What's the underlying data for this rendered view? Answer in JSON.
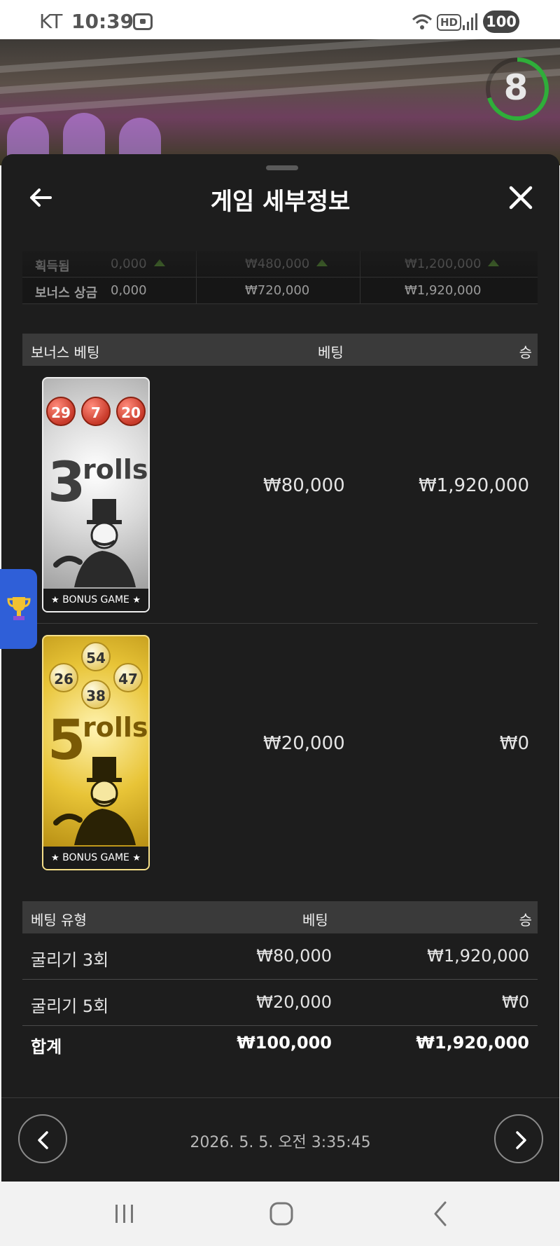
{
  "status_bar": {
    "carrier": "KT",
    "time": "10:39",
    "battery": "100"
  },
  "timer": {
    "value": "8",
    "progress_fraction": 0.7
  },
  "panel": {
    "title": "게임 세부정보"
  },
  "top_table": {
    "row1": {
      "label": "획득됨",
      "col1": "0,000",
      "col2": "₩480,000",
      "col3": "₩1,200,000"
    },
    "row2": {
      "label": "보너스 상금",
      "col1": "0,000",
      "col2": "₩720,000",
      "col3": "₩1,920,000"
    }
  },
  "bonus_section": {
    "header": {
      "type": "보너스 베팅",
      "bet": "베팅",
      "win": "승"
    },
    "rows": [
      {
        "card_number": "3",
        "card_word": "rolls",
        "balls": [
          "29",
          "7",
          "20"
        ],
        "card_footer": "BONUS GAME",
        "bet": "₩80,000",
        "win": "₩1,920,000"
      },
      {
        "card_number": "5",
        "card_word": "rolls",
        "balls": [
          "54",
          "26",
          "47",
          "38"
        ],
        "card_footer": "BONUS GAME",
        "bet": "₩20,000",
        "win": "₩0"
      }
    ]
  },
  "bet_type_section": {
    "header": {
      "type": "베팅 유형",
      "bet": "베팅",
      "win": "승"
    },
    "rows": [
      {
        "type": "굴리기 3회",
        "bet": "₩80,000",
        "win": "₩1,920,000"
      },
      {
        "type": "굴리기 5회",
        "bet": "₩20,000",
        "win": "₩0"
      }
    ],
    "total": {
      "type": "합계",
      "bet": "₩100,000",
      "win": "₩1,920,000"
    }
  },
  "footer": {
    "date": "2026. 5. 5. 오전 3:35:45"
  },
  "colors": {
    "panel_bg": "#1d1d1d",
    "header_bg": "#3a3a3a",
    "timer_accent": "#2fae3a",
    "trophy_tab": "#2f5fd8"
  }
}
